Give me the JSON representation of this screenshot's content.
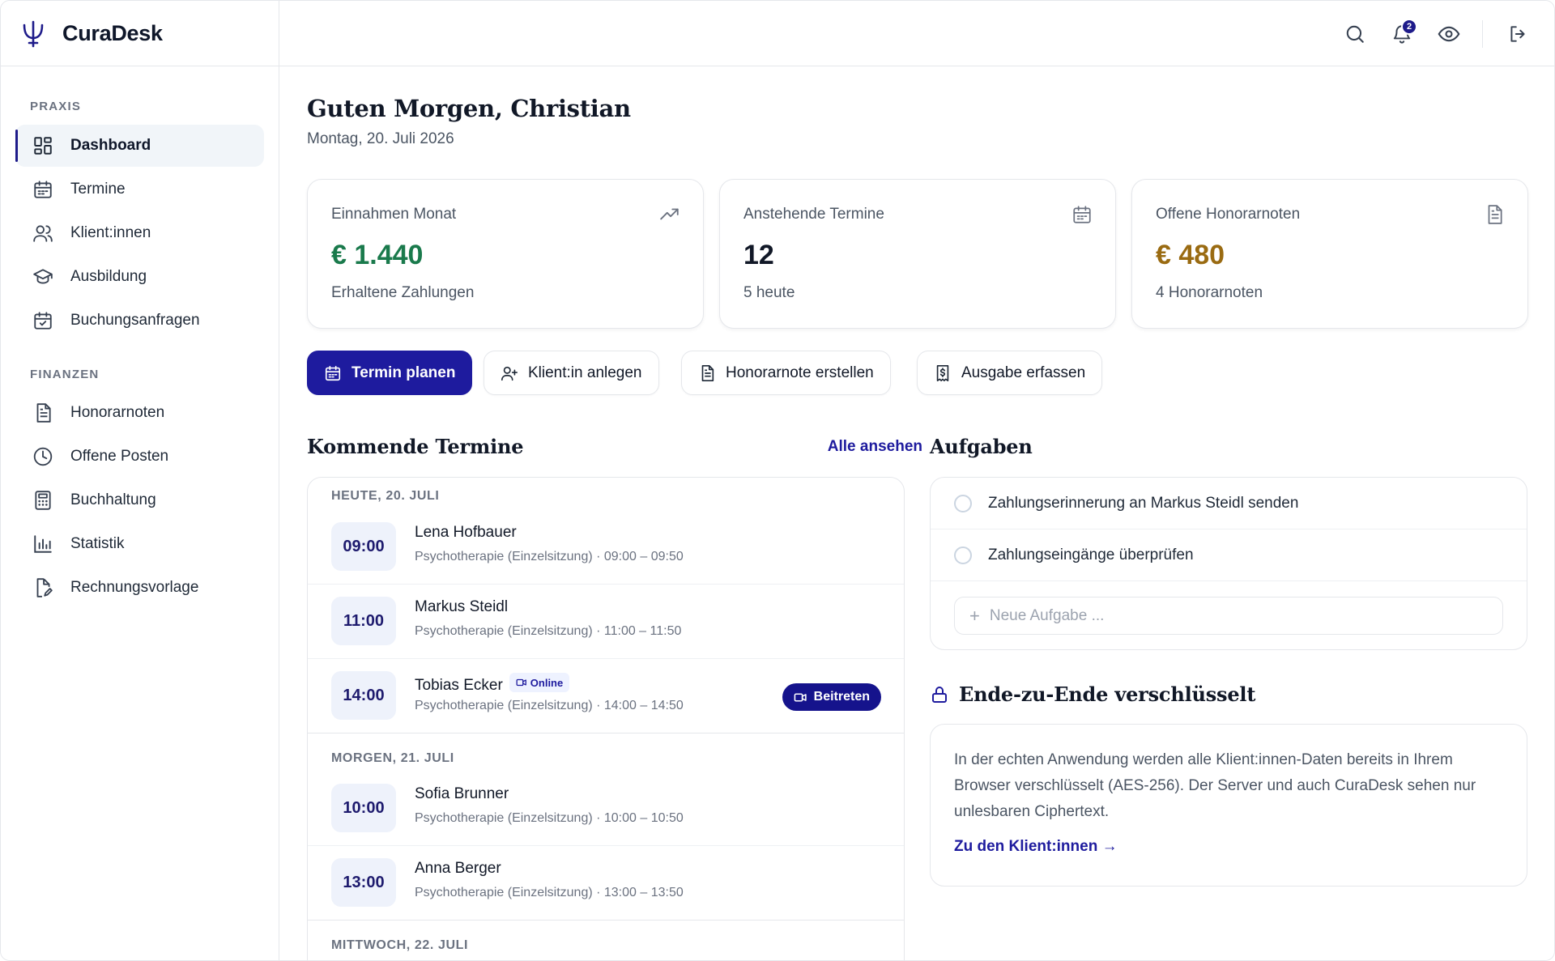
{
  "app": {
    "name": "CuraDesk"
  },
  "sidebar": {
    "sections": [
      {
        "title": "PRAXIS",
        "items": [
          {
            "label": "Dashboard",
            "icon": "dashboard-icon",
            "active": true
          },
          {
            "label": "Termine",
            "icon": "calendar-icon"
          },
          {
            "label": "Klient:innen",
            "icon": "users-icon"
          },
          {
            "label": "Ausbildung",
            "icon": "graduation-cap-icon"
          },
          {
            "label": "Buchungsanfragen",
            "icon": "calendar-check-icon"
          }
        ]
      },
      {
        "title": "FINANZEN",
        "items": [
          {
            "label": "Honorarnoten",
            "icon": "document-icon"
          },
          {
            "label": "Offene Posten",
            "icon": "clock-icon"
          },
          {
            "label": "Buchhaltung",
            "icon": "calculator-icon"
          },
          {
            "label": "Statistik",
            "icon": "bar-chart-icon"
          },
          {
            "label": "Rechnungsvorlage",
            "icon": "file-edit-icon"
          }
        ]
      }
    ]
  },
  "topbar": {
    "notification_count": "2"
  },
  "greeting": {
    "title": "Guten Morgen, Christian",
    "date": "Montag, 20. Juli 2026"
  },
  "stats": [
    {
      "title": "Einnahmen Monat",
      "value": "€ 1.440",
      "sub": "Erhaltene Zahlungen",
      "icon": "trending-up-icon",
      "color": "#1a7a4c"
    },
    {
      "title": "Anstehende Termine",
      "value": "12",
      "sub": "5 heute",
      "icon": "calendar-icon",
      "color": "#111827"
    },
    {
      "title": "Offene Honorarnoten",
      "value": "€ 480",
      "sub": "4 Honorarnoten",
      "icon": "document-icon",
      "color": "#9a6b12"
    }
  ],
  "actions": {
    "schedule": "Termin planen",
    "add_client": "Klient:in anlegen",
    "create_invoice": "Honorarnote erstellen",
    "record_expense": "Ausgabe erfassen"
  },
  "appointments": {
    "title": "Kommende Termine",
    "view_all": "Alle ansehen",
    "days": [
      {
        "label": "HEUTE, 20. JULI",
        "items": [
          {
            "time": "09:00",
            "name": "Lena Hofbauer",
            "meta": "Psychotherapie (Einzelsitzung) · 09:00 – 09:50"
          },
          {
            "time": "11:00",
            "name": "Markus Steidl",
            "meta": "Psychotherapie (Einzelsitzung) · 11:00 – 11:50"
          },
          {
            "time": "14:00",
            "name": "Tobias Ecker",
            "meta": "Psychotherapie (Einzelsitzung) · 14:00 – 14:50",
            "online": "Online",
            "join": "Beitreten"
          }
        ]
      },
      {
        "label": "MORGEN, 21. JULI",
        "items": [
          {
            "time": "10:00",
            "name": "Sofia Brunner",
            "meta": "Psychotherapie (Einzelsitzung) · 10:00 – 10:50"
          },
          {
            "time": "13:00",
            "name": "Anna Berger",
            "meta": "Psychotherapie (Einzelsitzung) · 13:00 – 13:50"
          }
        ]
      },
      {
        "label": "MITTWOCH, 22. JULI",
        "items": []
      }
    ]
  },
  "tasks": {
    "title": "Aufgaben",
    "items": [
      "Zahlungserinnerung an Markus Steidl senden",
      "Zahlungseingänge überprüfen"
    ],
    "new_placeholder": "Neue Aufgabe ..."
  },
  "encryption": {
    "title": "Ende-zu-Ende verschlüsselt",
    "text": "In der echten Anwendung werden alle Klient:innen-Daten bereits in Ihrem Browser verschlüsselt (AES-256). Der Server und auch CuraDesk sehen nur unlesbaren Ciphertext.",
    "link": "Zu den Klient:innen →"
  }
}
